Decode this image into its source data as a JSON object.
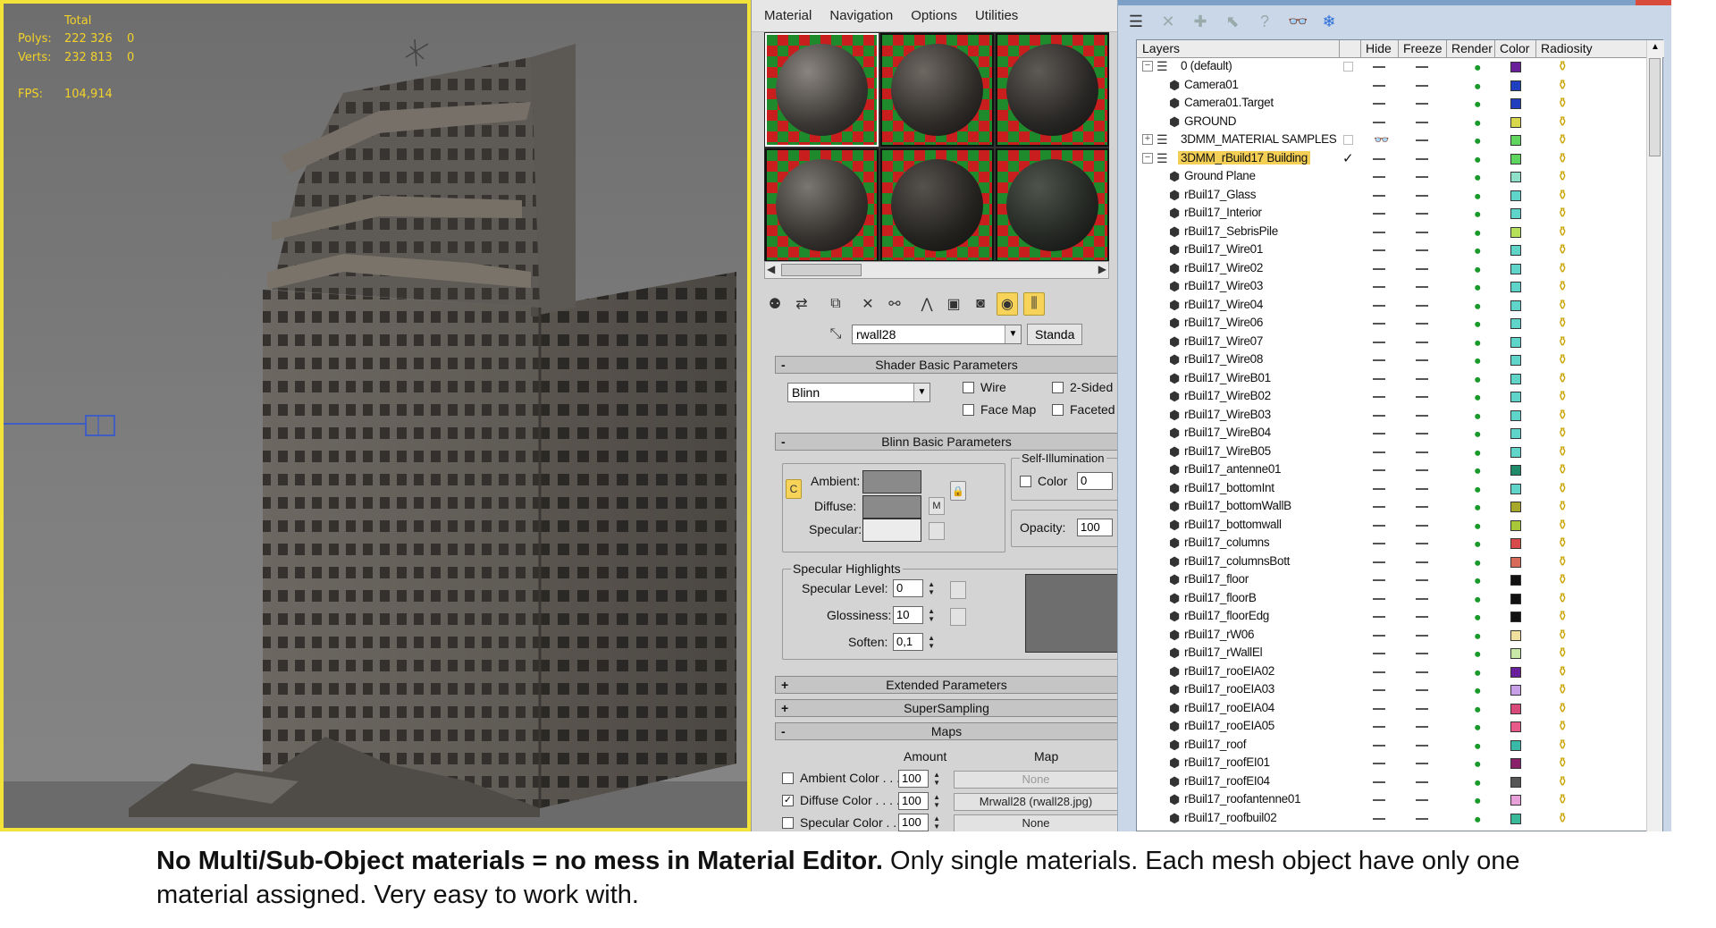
{
  "viewport": {
    "stats": {
      "total_label": "Total",
      "polys_label": "Polys:",
      "polys_value": "222 326",
      "polys_sel": "0",
      "verts_label": "Verts:",
      "verts_value": "232 813",
      "verts_sel": "0",
      "fps_label": "FPS:",
      "fps_value": "104,914"
    },
    "colors": {
      "border": "#f2e23a",
      "stats_text": "#f2d22a"
    }
  },
  "material_editor": {
    "menu": [
      "Material",
      "Navigation",
      "Options",
      "Utilities"
    ],
    "material_name": "rwall28",
    "material_type_button": "Standa",
    "rollouts": {
      "shader_basic": "Shader Basic Parameters",
      "blinn_basic": "Blinn Basic Parameters",
      "extended": "Extended Parameters",
      "supersampling": "SuperSampling",
      "maps": "Maps"
    },
    "shader": {
      "type": "Blinn",
      "wire": "Wire",
      "two_sided": "2-Sided",
      "face_map": "Face Map",
      "faceted": "Faceted"
    },
    "blinn": {
      "ambient": "Ambient:",
      "diffuse": "Diffuse:",
      "specular": "Specular:",
      "m_button": "M",
      "self_illum_label": "Self-Illumination",
      "color_label": "Color",
      "color_value": "0",
      "opacity_label": "Opacity:",
      "opacity_value": "100",
      "specular_highlights_label": "Specular Highlights",
      "spec_level_label": "Specular Level:",
      "spec_level_value": "0",
      "glossiness_label": "Glossiness:",
      "glossiness_value": "10",
      "soften_label": "Soften:",
      "soften_value": "0,1"
    },
    "maps": {
      "amount_header": "Amount",
      "map_header": "Map",
      "rows": [
        {
          "label": "Ambient Color . . .",
          "checked": false,
          "amount": "100",
          "map": "None"
        },
        {
          "label": "Diffuse Color . . . .",
          "checked": true,
          "amount": "100",
          "map": "Mrwall28 (rwall28.jpg)"
        },
        {
          "label": "Specular Color . .",
          "checked": false,
          "amount": "100",
          "map": "None"
        }
      ]
    }
  },
  "layer_manager": {
    "columns": {
      "layers": "Layers",
      "hide": "Hide",
      "freeze": "Freeze",
      "render": "Render",
      "color": "Color",
      "radiosity": "Radiosity"
    },
    "rows": [
      {
        "name": "0 (default)",
        "kind": "layer",
        "tree": "−",
        "color": "#6a1f9a",
        "box": true
      },
      {
        "name": "Camera01",
        "kind": "object",
        "color": "#1f3fbf"
      },
      {
        "name": "Camera01.Target",
        "kind": "object",
        "color": "#1f3fbf"
      },
      {
        "name": "GROUND",
        "kind": "object",
        "color": "#d8d84a"
      },
      {
        "name": "3DMM_MATERIAL SAMPLES",
        "kind": "layer",
        "tree": "+",
        "color": "#5fd45f",
        "box": true,
        "hidden": true
      },
      {
        "name": "3DMM_rBuild17 Building",
        "kind": "layer",
        "tree": "−",
        "color": "#5fd45f",
        "selected": true,
        "current": true
      },
      {
        "name": "Ground Plane",
        "kind": "object",
        "color": "#8fe0c8"
      },
      {
        "name": "rBuil17_Glass",
        "kind": "object",
        "color": "#5fd4c8"
      },
      {
        "name": "rBuil17_Interior",
        "kind": "object",
        "color": "#5fd4c8"
      },
      {
        "name": "rBuil17_SebrisPile",
        "kind": "object",
        "color": "#b4e05a"
      },
      {
        "name": "rBuil17_Wire01",
        "kind": "object",
        "color": "#5fd4c8"
      },
      {
        "name": "rBuil17_Wire02",
        "kind": "object",
        "color": "#5fd4c8"
      },
      {
        "name": "rBuil17_Wire03",
        "kind": "object",
        "color": "#5fd4c8"
      },
      {
        "name": "rBuil17_Wire04",
        "kind": "object",
        "color": "#5fd4c8"
      },
      {
        "name": "rBuil17_Wire06",
        "kind": "object",
        "color": "#5fd4c8"
      },
      {
        "name": "rBuil17_Wire07",
        "kind": "object",
        "color": "#5fd4c8"
      },
      {
        "name": "rBuil17_Wire08",
        "kind": "object",
        "color": "#5fd4c8"
      },
      {
        "name": "rBuil17_WireB01",
        "kind": "object",
        "color": "#5fd4c8"
      },
      {
        "name": "rBuil17_WireB02",
        "kind": "object",
        "color": "#5fd4c8"
      },
      {
        "name": "rBuil17_WireB03",
        "kind": "object",
        "color": "#5fd4c8"
      },
      {
        "name": "rBuil17_WireB04",
        "kind": "object",
        "color": "#5fd4c8"
      },
      {
        "name": "rBuil17_WireB05",
        "kind": "object",
        "color": "#5fd4c8"
      },
      {
        "name": "rBuil17_antenne01",
        "kind": "object",
        "color": "#1f8a6a"
      },
      {
        "name": "rBuil17_bottomInt",
        "kind": "object",
        "color": "#5fd4c8"
      },
      {
        "name": "rBuil17_bottomWallB",
        "kind": "object",
        "color": "#a8a82a"
      },
      {
        "name": "rBuil17_bottomwall",
        "kind": "object",
        "color": "#a8c83a"
      },
      {
        "name": "rBuil17_columns",
        "kind": "object",
        "color": "#d84a4a"
      },
      {
        "name": "rBuil17_columnsBott",
        "kind": "object",
        "color": "#d86a5a"
      },
      {
        "name": "rBuil17_floor",
        "kind": "object",
        "color": "#111111"
      },
      {
        "name": "rBuil17_floorB",
        "kind": "object",
        "color": "#111111"
      },
      {
        "name": "rBuil17_floorEdg",
        "kind": "object",
        "color": "#111111"
      },
      {
        "name": "rBuil17_rW06",
        "kind": "object",
        "color": "#efe0a0"
      },
      {
        "name": "rBuil17_rWallEl",
        "kind": "object",
        "color": "#c8e8a8"
      },
      {
        "name": "rBuil17_rooEIA02",
        "kind": "object",
        "color": "#6a1f9a"
      },
      {
        "name": "rBuil17_rooEIA03",
        "kind": "object",
        "color": "#c8a0e8"
      },
      {
        "name": "rBuil17_rooEIA04",
        "kind": "object",
        "color": "#d84a7a"
      },
      {
        "name": "rBuil17_rooEIA05",
        "kind": "object",
        "color": "#e85a8a"
      },
      {
        "name": "rBuil17_roof",
        "kind": "object",
        "color": "#3ab8a8"
      },
      {
        "name": "rBuil17_roofEI01",
        "kind": "object",
        "color": "#8a1f6a"
      },
      {
        "name": "rBuil17_roofEI04",
        "kind": "object",
        "color": "#555555"
      },
      {
        "name": "rBuil17_roofantenne01",
        "kind": "object",
        "color": "#e8a0d8"
      },
      {
        "name": "rBuil17_roofbuil02",
        "kind": "object",
        "color": "#3ab89a"
      }
    ]
  },
  "caption": {
    "bold": "No Multi/Sub-Object materials = no mess in Material Editor.",
    "rest": " Only single materials. Each mesh object have only one material assigned. Very easy to work with."
  }
}
